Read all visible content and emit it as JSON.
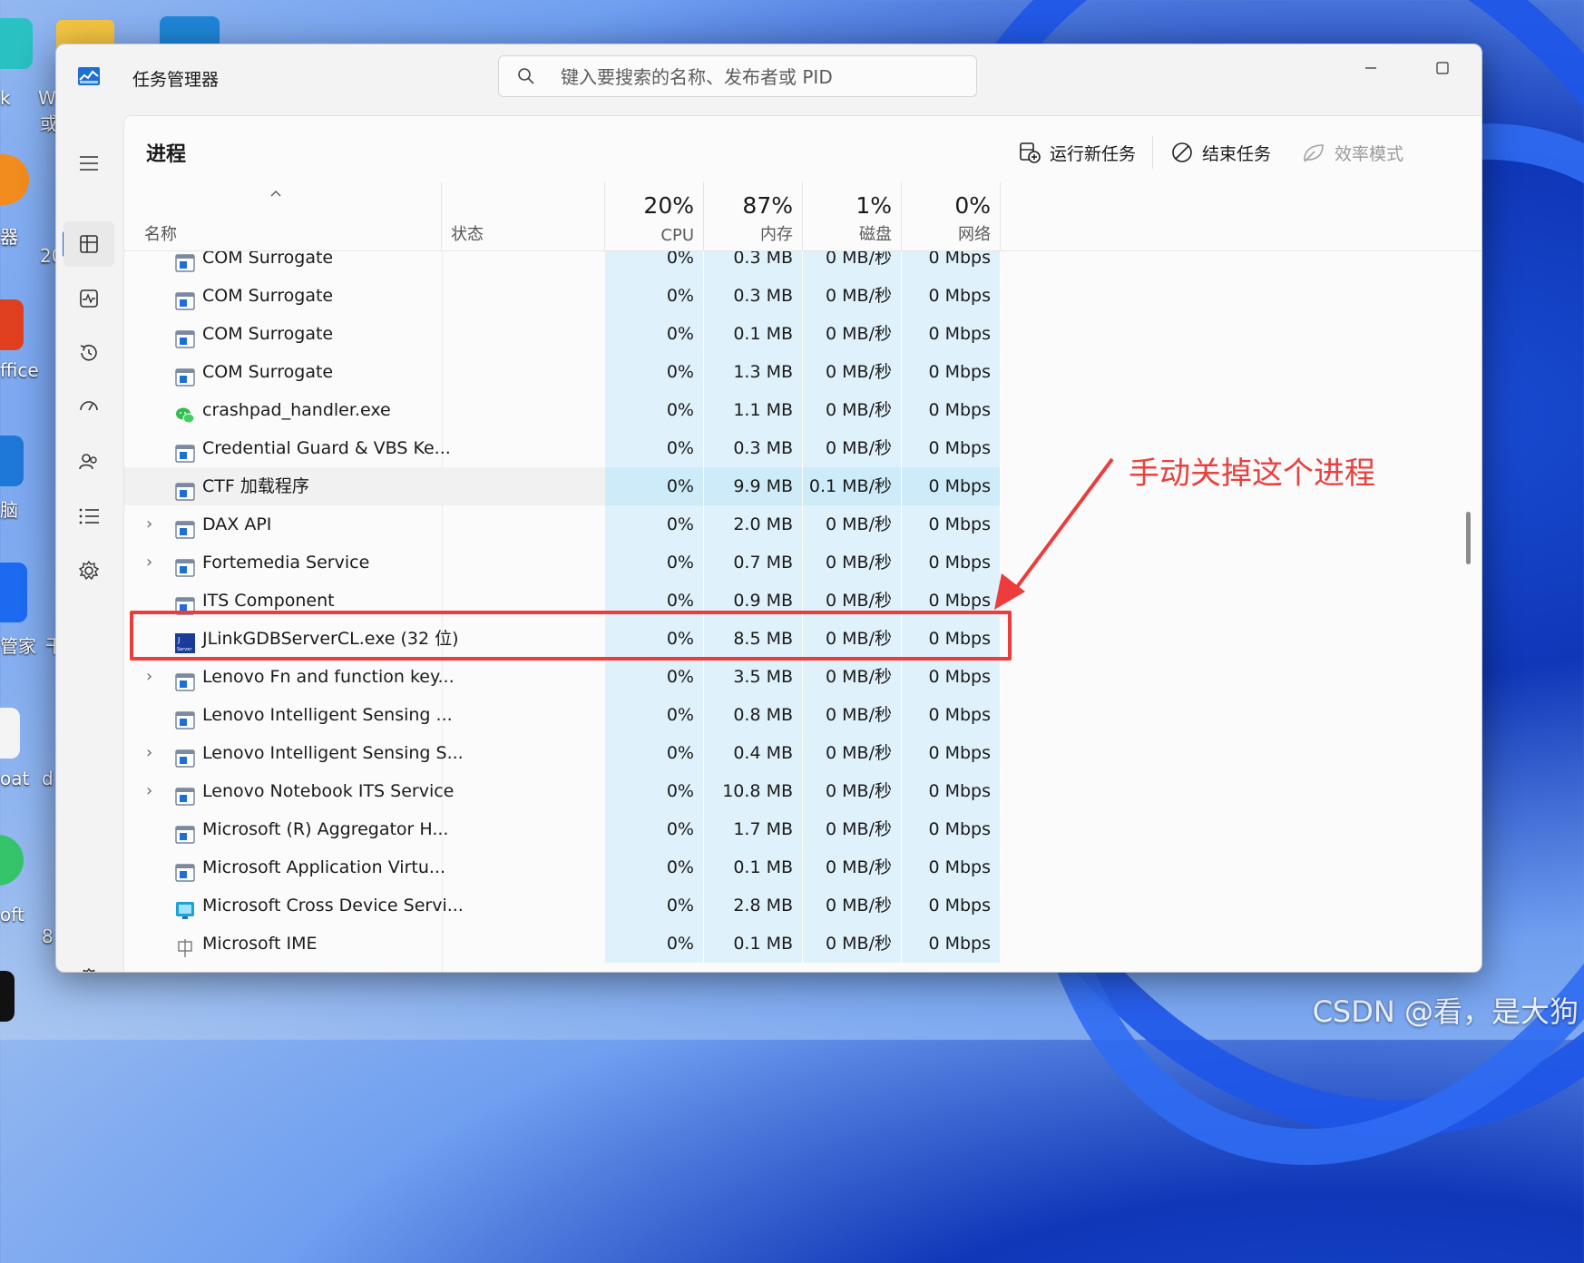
{
  "desktop": {
    "labels": [
      "k",
      "W",
      "或",
      "器",
      "20",
      "ffice",
      "脑",
      "管家",
      "干",
      "oat",
      "d",
      "oft",
      "8"
    ],
    "watermark": "CSDN @看，是大狗"
  },
  "window": {
    "title": "任务管理器",
    "search_placeholder": "键入要搜索的名称、发布者或 PID",
    "controls": {
      "minimize": "minimize-icon",
      "maximize": "maximize-icon",
      "close": "close-icon"
    }
  },
  "nav": {
    "items": [
      "menu-icon",
      "processes-icon",
      "performance-icon",
      "app-history-icon",
      "startup-apps-icon",
      "users-icon",
      "details-icon",
      "services-icon",
      "settings-icon"
    ],
    "active": "processes-icon"
  },
  "toolbar": {
    "page_title": "进程",
    "run_new_task": "运行新任务",
    "end_task": "结束任务",
    "efficiency_mode": "效率模式",
    "more": "···"
  },
  "columns": {
    "name": "名称",
    "status": "状态",
    "cpu": {
      "pct": "20%",
      "label": "CPU"
    },
    "memory": {
      "pct": "87%",
      "label": "内存"
    },
    "disk": {
      "pct": "1%",
      "label": "磁盘"
    },
    "network": {
      "pct": "0%",
      "label": "网络"
    }
  },
  "processes": [
    {
      "name": "COM Surrogate",
      "icon": "window-icon",
      "expandable": false,
      "cpu": "0%",
      "mem": "0.3 MB",
      "disk": "0 MB/秒",
      "net": "0 Mbps"
    },
    {
      "name": "COM Surrogate",
      "icon": "window-icon",
      "expandable": false,
      "cpu": "0%",
      "mem": "0.3 MB",
      "disk": "0 MB/秒",
      "net": "0 Mbps"
    },
    {
      "name": "COM Surrogate",
      "icon": "window-icon",
      "expandable": false,
      "cpu": "0%",
      "mem": "0.1 MB",
      "disk": "0 MB/秒",
      "net": "0 Mbps"
    },
    {
      "name": "COM Surrogate",
      "icon": "window-icon",
      "expandable": false,
      "cpu": "0%",
      "mem": "1.3 MB",
      "disk": "0 MB/秒",
      "net": "0 Mbps"
    },
    {
      "name": "crashpad_handler.exe",
      "icon": "wechat-icon",
      "expandable": false,
      "cpu": "0%",
      "mem": "1.1 MB",
      "disk": "0 MB/秒",
      "net": "0 Mbps"
    },
    {
      "name": "Credential Guard & VBS Ke...",
      "icon": "window-icon",
      "expandable": false,
      "cpu": "0%",
      "mem": "0.3 MB",
      "disk": "0 MB/秒",
      "net": "0 Mbps"
    },
    {
      "name": "CTF 加载程序",
      "icon": "window-icon",
      "expandable": false,
      "cpu": "0%",
      "mem": "9.9 MB",
      "disk": "0.1 MB/秒",
      "net": "0 Mbps",
      "highlighted": true
    },
    {
      "name": "DAX API",
      "icon": "window-icon",
      "expandable": true,
      "cpu": "0%",
      "mem": "2.0 MB",
      "disk": "0 MB/秒",
      "net": "0 Mbps"
    },
    {
      "name": "Fortemedia Service",
      "icon": "window-icon",
      "expandable": true,
      "cpu": "0%",
      "mem": "0.7 MB",
      "disk": "0 MB/秒",
      "net": "0 Mbps"
    },
    {
      "name": "ITS Component",
      "icon": "window-icon",
      "expandable": false,
      "cpu": "0%",
      "mem": "0.9 MB",
      "disk": "0 MB/秒",
      "net": "0 Mbps"
    },
    {
      "name": "JLinkGDBServerCL.exe (32 位)",
      "icon": "jlink-icon",
      "expandable": false,
      "cpu": "0%",
      "mem": "8.5 MB",
      "disk": "0 MB/秒",
      "net": "0 Mbps"
    },
    {
      "name": "Lenovo Fn and function key...",
      "icon": "window-icon",
      "expandable": true,
      "cpu": "0%",
      "mem": "3.5 MB",
      "disk": "0 MB/秒",
      "net": "0 Mbps"
    },
    {
      "name": "Lenovo Intelligent Sensing ...",
      "icon": "window-icon",
      "expandable": false,
      "cpu": "0%",
      "mem": "0.8 MB",
      "disk": "0 MB/秒",
      "net": "0 Mbps"
    },
    {
      "name": "Lenovo Intelligent Sensing S...",
      "icon": "window-icon",
      "expandable": true,
      "cpu": "0%",
      "mem": "0.4 MB",
      "disk": "0 MB/秒",
      "net": "0 Mbps"
    },
    {
      "name": "Lenovo Notebook ITS Service",
      "icon": "window-icon",
      "expandable": true,
      "cpu": "0%",
      "mem": "10.8 MB",
      "disk": "0 MB/秒",
      "net": "0 Mbps"
    },
    {
      "name": "Microsoft (R) Aggregator H...",
      "icon": "window-icon",
      "expandable": false,
      "cpu": "0%",
      "mem": "1.7 MB",
      "disk": "0 MB/秒",
      "net": "0 Mbps"
    },
    {
      "name": "Microsoft Application Virtu...",
      "icon": "window-icon",
      "expandable": false,
      "cpu": "0%",
      "mem": "0.1 MB",
      "disk": "0 MB/秒",
      "net": "0 Mbps"
    },
    {
      "name": "Microsoft Cross Device Servi...",
      "icon": "cross-device-icon",
      "expandable": false,
      "cpu": "0%",
      "mem": "2.8 MB",
      "disk": "0 MB/秒",
      "net": "0 Mbps"
    },
    {
      "name": "Microsoft IME",
      "icon": "ime-icon",
      "expandable": false,
      "cpu": "0%",
      "mem": "0.1 MB",
      "disk": "0 MB/秒",
      "net": "0 Mbps"
    }
  ],
  "annotation": {
    "text": "手动关掉这个进程",
    "target": "JLinkGDBServerCL.exe (32 位)",
    "color": "#e8423f"
  },
  "colors": {
    "accent": "#1a5fc7",
    "heatmap": "#dff1fb",
    "annotation": "#ee3b3b"
  }
}
